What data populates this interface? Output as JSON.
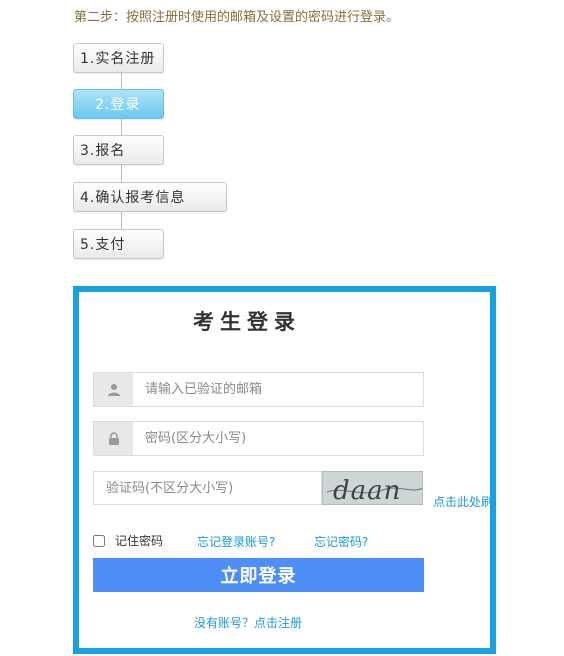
{
  "step_heading": "第二步：按照注册时使用的邮箱及设置的密码进行登录。",
  "steps": [
    {
      "label": "1.实名注册",
      "active": false
    },
    {
      "label": "2.登录",
      "active": true
    },
    {
      "label": "3.报名",
      "active": false
    },
    {
      "label": "4.确认报考信息",
      "active": false
    },
    {
      "label": "5.支付",
      "active": false
    }
  ],
  "login": {
    "title": "考生登录",
    "email_placeholder": "请输入已验证的邮箱",
    "password_placeholder": "密码(区分大小写)",
    "captcha_placeholder": "验证码(不区分大小写)",
    "captcha_text": "daan",
    "refresh_label": "点击此处刷",
    "remember_label": "记住密码",
    "forgot_account": "忘记登录账号?",
    "forgot_password": "忘记密码?",
    "submit_label": "立即登录",
    "register_link": "没有账号？点击注册"
  },
  "colors": {
    "frame": "#1aa0e0",
    "button": "#4e8ef7",
    "link": "#1a9ad6",
    "active_step": "#6cc8f0",
    "heading": "#8a6d3b"
  },
  "icons": {
    "email": "user-icon",
    "password": "lock-icon"
  }
}
